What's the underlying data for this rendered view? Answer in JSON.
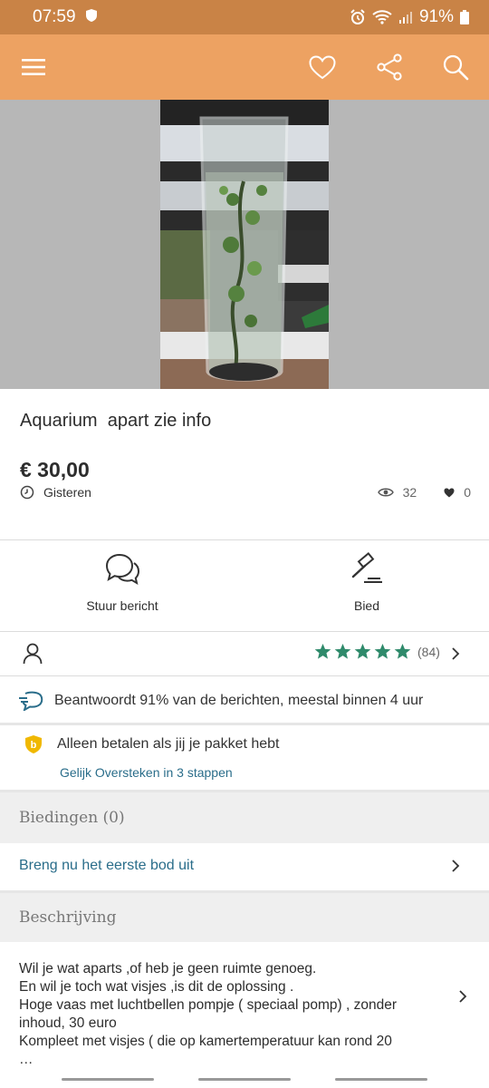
{
  "status_bar": {
    "time": "07:59",
    "battery": "91%"
  },
  "listing": {
    "title": "Aquarium  apart zie info",
    "price": "€ 30,00",
    "date": "Gisteren",
    "views": "32",
    "favorites": "0"
  },
  "actions": {
    "message_label": "Stuur bericht",
    "bid_label": "Bied"
  },
  "seller": {
    "rating_stars": 5,
    "review_count": "(84)"
  },
  "info": {
    "response_text": "Beantwoordt 91% van de berichten, meestal binnen 4 uur",
    "payment_text": "Alleen betalen als jij je pakket hebt",
    "payment_link": "Gelijk Oversteken in 3 stappen"
  },
  "bids": {
    "header": "Biedingen (0)",
    "first_bid_link": "Breng nu het eerste bod uit"
  },
  "description": {
    "header": "Beschrijving",
    "lines": [
      "Wil je wat aparts ,of heb je geen ruimte genoeg.",
      "En wil je toch wat visjes ,is dit de oplossing .",
      "Hoge vaas met luchtbellen pompje ( speciaal pomp) , zonder",
      "inhoud, 30 euro",
      "Kompleet met visjes ( die op kamertemperatuur kan rond 20",
      "…"
    ]
  },
  "colors": {
    "header": "#eda262",
    "statusbar": "#c98346",
    "link": "#2a6d8a",
    "stars": "#2f8a6b"
  },
  "icons": [
    "menu-icon",
    "heart-icon",
    "share-icon",
    "search-icon",
    "clock-icon",
    "eye-icon",
    "chat-icon",
    "gavel-icon",
    "user-icon",
    "star-icon",
    "chevron-right-icon",
    "response-icon",
    "shield-icon"
  ]
}
